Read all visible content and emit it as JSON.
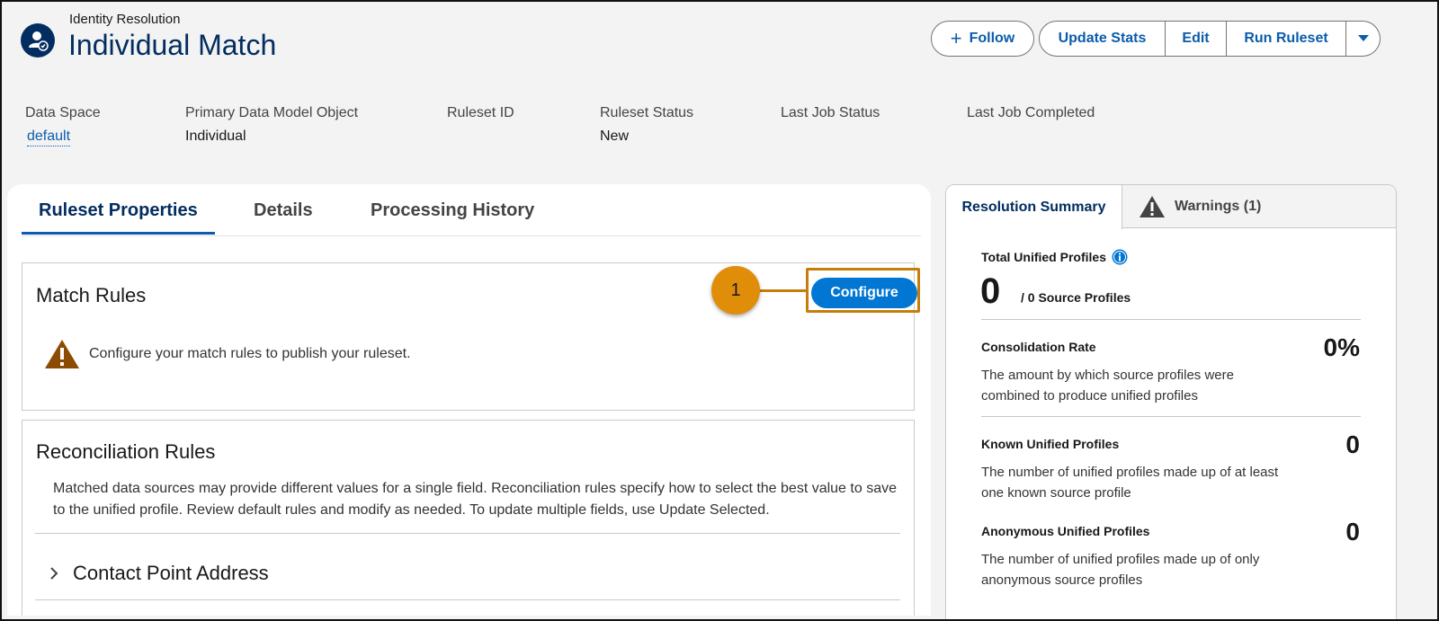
{
  "header": {
    "object_type": "Identity Resolution",
    "title": "Individual Match",
    "icon": "identity-resolution-icon",
    "follow_label": "Follow",
    "actions": [
      "Update Stats",
      "Edit",
      "Run Ruleset"
    ],
    "more_icon": "chevron-down-icon"
  },
  "highlights": {
    "data_space_label": "Data Space",
    "data_space_value": "default",
    "primary_dmo_label": "Primary Data Model Object",
    "primary_dmo_value": "Individual",
    "ruleset_id_label": "Ruleset ID",
    "ruleset_status_label": "Ruleset Status",
    "ruleset_status_value": "New",
    "last_job_status_label": "Last Job Status",
    "last_job_completed_label": "Last Job Completed"
  },
  "tabs": [
    "Ruleset Properties",
    "Details",
    "Processing History"
  ],
  "match_rules": {
    "title": "Match Rules",
    "configure_label": "Configure",
    "callout_number": "1",
    "warning": "Configure your match rules to publish your ruleset."
  },
  "reconciliation": {
    "title": "Reconciliation Rules",
    "description": "Matched data sources may provide different values for a single field. Reconciliation rules specify how to select the best value to save to the unified profile. Review default rules and modify as needed. To update multiple fields, use Update Selected.",
    "accordion_item": "Contact Point Address"
  },
  "summary": {
    "tab_active": "Resolution Summary",
    "tab_warnings": "Warnings (1)",
    "total_label": "Total Unified Profiles",
    "total_value": "0",
    "source_profiles": "/ 0 Source Profiles",
    "consolidation_label": "Consolidation Rate",
    "consolidation_value": "0%",
    "consolidation_desc": "The amount by which source profiles were combined to produce unified profiles",
    "known_label": "Known Unified Profiles",
    "known_value": "0",
    "known_desc": "The number of unified profiles made up of at least one known source profile",
    "anon_label": "Anonymous Unified Profiles",
    "anon_value": "0",
    "anon_desc": "The number of unified profiles made up of only anonymous source profiles"
  },
  "colors": {
    "brand_blue": "#0176d3",
    "navy": "#032d60",
    "callout_orange": "#e08d0a"
  }
}
